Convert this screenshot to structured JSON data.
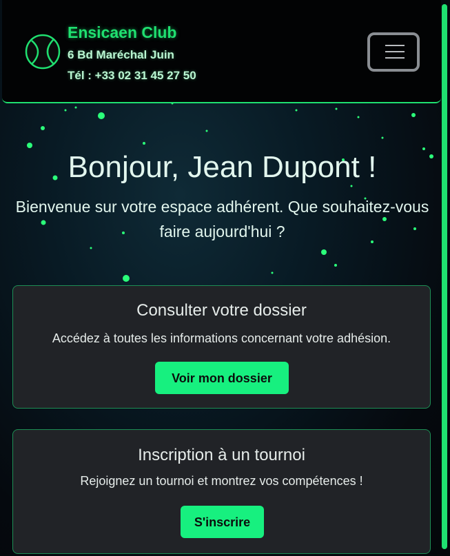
{
  "header": {
    "club_name": "Ensicaen Club",
    "address": "6 Bd Maréchal Juin",
    "phone": "Tél : +33 02 31 45 27 50",
    "logo_icon": "tennis-ball-icon",
    "menu_icon": "hamburger-menu-icon"
  },
  "hero": {
    "greeting": "Bonjour, Jean Dupont !",
    "welcome": "Bienvenue sur votre espace adhérent. Que souhaitez-vous faire aujourd'hui ?"
  },
  "cards": [
    {
      "title": "Consulter votre dossier",
      "text": "Accédez à toutes les informations concernant votre adhésion.",
      "button": "Voir mon dossier"
    },
    {
      "title": "Inscription à un tournoi",
      "text": "Rejoignez un tournoi et montrez vos compétences !",
      "button": "S'inscrire"
    }
  ],
  "colors": {
    "accent": "#1fe070",
    "button": "#17f07f",
    "card_bg": "#212327",
    "navbar_bg": "#020304"
  }
}
